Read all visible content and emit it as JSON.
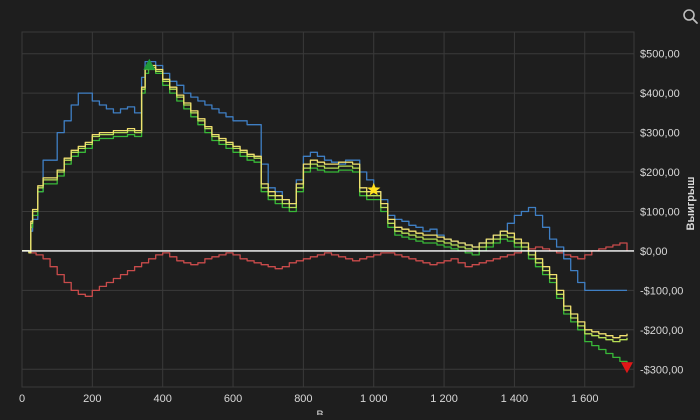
{
  "colors": {
    "background": "#1e1e1e",
    "grid": "#3a3a3a",
    "axis_text": "#d8d8d8",
    "zero_line": "#ffffff",
    "blue": "#3f7fc4",
    "red": "#c94b4b",
    "green": "#38b838",
    "lightgreen": "#b6df55",
    "yellow": "#f0e070",
    "marker_peak": "#1f9a3a",
    "marker_star": "#ffe020",
    "marker_low": "#e01818"
  },
  "toolbar": {
    "zoom_icon": "magnifier-icon"
  },
  "chart_data": {
    "type": "line",
    "ylabel": "Выигрыш",
    "xlabel": "В",
    "xlim": [
      0,
      1740
    ],
    "ylim": [
      -345,
      555
    ],
    "x_ticks": [
      0,
      200,
      400,
      600,
      800,
      1000,
      1200,
      1400,
      1600
    ],
    "x_tick_labels": [
      "0",
      "200",
      "400",
      "600",
      "800",
      "1 000",
      "1 200",
      "1 400",
      "1 600"
    ],
    "y_ticks": [
      500,
      400,
      300,
      200,
      100,
      0,
      -100,
      -200,
      -300
    ],
    "y_tick_labels": [
      "$500,00",
      "$400,00",
      "$300,00",
      "$200,00",
      "$100,00",
      "$0,00",
      "-$100,00",
      "-$200,00",
      "-$300,00"
    ],
    "grid": true,
    "series": [
      {
        "color_key": "blue",
        "x": [
          0,
          20,
          25,
          30,
          45,
          60,
          100,
          120,
          140,
          160,
          180,
          200,
          220,
          240,
          260,
          280,
          300,
          320,
          340,
          350,
          360,
          380,
          400,
          420,
          440,
          460,
          480,
          500,
          520,
          540,
          560,
          580,
          600,
          620,
          640,
          660,
          680,
          700,
          720,
          740,
          760,
          780,
          800,
          820,
          840,
          860,
          880,
          900,
          920,
          940,
          960,
          980,
          1000,
          1020,
          1040,
          1060,
          1080,
          1100,
          1120,
          1140,
          1160,
          1180,
          1200,
          1220,
          1240,
          1260,
          1280,
          1300,
          1320,
          1340,
          1360,
          1380,
          1400,
          1420,
          1440,
          1460,
          1480,
          1500,
          1520,
          1540,
          1560,
          1580,
          1600,
          1620,
          1640,
          1660,
          1680,
          1700,
          1720
        ],
        "y": [
          0,
          -5,
          50,
          80,
          150,
          230,
          300,
          330,
          370,
          400,
          400,
          380,
          370,
          360,
          350,
          360,
          365,
          350,
          440,
          480,
          480,
          470,
          450,
          430,
          420,
          400,
          390,
          380,
          370,
          360,
          350,
          340,
          330,
          330,
          320,
          320,
          220,
          160,
          150,
          130,
          120,
          180,
          240,
          250,
          240,
          230,
          225,
          220,
          230,
          230,
          200,
          180,
          150,
          130,
          90,
          80,
          75,
          65,
          60,
          50,
          55,
          40,
          30,
          25,
          20,
          15,
          10,
          20,
          30,
          40,
          50,
          70,
          90,
          100,
          110,
          90,
          60,
          30,
          10,
          -20,
          -50,
          -80,
          -100,
          -100,
          -100,
          -100,
          -100,
          -100,
          -100
        ]
      },
      {
        "color_key": "red",
        "x": [
          0,
          20,
          40,
          60,
          80,
          100,
          120,
          140,
          160,
          180,
          200,
          220,
          240,
          260,
          280,
          300,
          320,
          340,
          360,
          380,
          400,
          420,
          440,
          460,
          480,
          500,
          520,
          540,
          560,
          580,
          600,
          620,
          640,
          660,
          680,
          700,
          720,
          740,
          760,
          780,
          800,
          820,
          840,
          860,
          880,
          900,
          920,
          940,
          960,
          980,
          1000,
          1020,
          1040,
          1060,
          1080,
          1100,
          1120,
          1140,
          1160,
          1180,
          1200,
          1220,
          1240,
          1260,
          1280,
          1300,
          1320,
          1340,
          1360,
          1380,
          1400,
          1420,
          1440,
          1460,
          1480,
          1500,
          1520,
          1540,
          1560,
          1580,
          1600,
          1620,
          1640,
          1660,
          1680,
          1700,
          1720
        ],
        "y": [
          0,
          -5,
          -10,
          -20,
          -40,
          -60,
          -80,
          -100,
          -110,
          -115,
          -100,
          -90,
          -80,
          -70,
          -60,
          -50,
          -40,
          -30,
          -20,
          -10,
          -5,
          -15,
          -25,
          -30,
          -35,
          -30,
          -20,
          -15,
          -10,
          -5,
          -10,
          -20,
          -25,
          -30,
          -35,
          -40,
          -45,
          -40,
          -30,
          -25,
          -20,
          -15,
          -10,
          -5,
          -10,
          -15,
          -20,
          -25,
          -20,
          -15,
          -10,
          -5,
          -5,
          -10,
          -15,
          -20,
          -25,
          -30,
          -35,
          -30,
          -25,
          -20,
          -30,
          -40,
          -35,
          -30,
          -25,
          -20,
          -15,
          -10,
          -5,
          0,
          5,
          10,
          5,
          0,
          -5,
          -10,
          -15,
          -20,
          -10,
          0,
          5,
          10,
          15,
          20,
          0
        ]
      },
      {
        "color_key": "green",
        "x": [
          0,
          20,
          25,
          30,
          45,
          60,
          100,
          120,
          140,
          160,
          180,
          200,
          220,
          240,
          260,
          280,
          300,
          320,
          340,
          350,
          360,
          380,
          400,
          420,
          440,
          460,
          480,
          500,
          520,
          540,
          560,
          580,
          600,
          620,
          640,
          660,
          680,
          700,
          720,
          740,
          760,
          780,
          800,
          820,
          840,
          860,
          880,
          900,
          920,
          940,
          960,
          980,
          1000,
          1020,
          1040,
          1060,
          1080,
          1100,
          1120,
          1140,
          1160,
          1180,
          1200,
          1220,
          1240,
          1260,
          1280,
          1300,
          1320,
          1340,
          1360,
          1380,
          1400,
          1420,
          1440,
          1460,
          1480,
          1500,
          1520,
          1540,
          1560,
          1580,
          1600,
          1620,
          1640,
          1660,
          1680,
          1700,
          1720
        ],
        "y": [
          0,
          -5,
          60,
          90,
          150,
          170,
          190,
          220,
          240,
          250,
          260,
          280,
          285,
          285,
          290,
          290,
          295,
          290,
          400,
          450,
          460,
          450,
          420,
          400,
          380,
          360,
          340,
          320,
          300,
          280,
          270,
          260,
          250,
          240,
          230,
          225,
          150,
          130,
          120,
          110,
          100,
          150,
          200,
          210,
          205,
          200,
          200,
          205,
          205,
          200,
          140,
          130,
          130,
          100,
          60,
          40,
          35,
          30,
          25,
          20,
          20,
          15,
          10,
          5,
          0,
          -5,
          -10,
          0,
          10,
          20,
          30,
          25,
          10,
          0,
          -20,
          -40,
          -60,
          -80,
          -120,
          -160,
          -180,
          -200,
          -230,
          -240,
          -250,
          -260,
          -270,
          -280,
          -285
        ]
      },
      {
        "color_key": "lightgreen",
        "x": [
          0,
          20,
          25,
          30,
          45,
          60,
          100,
          120,
          140,
          160,
          180,
          200,
          220,
          240,
          260,
          280,
          300,
          320,
          340,
          350,
          360,
          380,
          400,
          420,
          440,
          460,
          480,
          500,
          520,
          540,
          560,
          580,
          600,
          620,
          640,
          660,
          680,
          700,
          720,
          740,
          760,
          780,
          800,
          820,
          840,
          860,
          880,
          900,
          920,
          940,
          960,
          980,
          1000,
          1020,
          1040,
          1060,
          1080,
          1100,
          1120,
          1140,
          1160,
          1180,
          1200,
          1220,
          1240,
          1260,
          1280,
          1300,
          1320,
          1340,
          1360,
          1380,
          1400,
          1420,
          1440,
          1460,
          1480,
          1500,
          1520,
          1540,
          1560,
          1580,
          1600,
          1620,
          1640,
          1660,
          1680,
          1700,
          1720
        ],
        "y": [
          0,
          -5,
          70,
          100,
          160,
          180,
          200,
          230,
          250,
          260,
          270,
          290,
          295,
          295,
          300,
          300,
          305,
          300,
          410,
          460,
          465,
          455,
          430,
          410,
          390,
          370,
          350,
          330,
          310,
          290,
          280,
          270,
          260,
          250,
          240,
          235,
          160,
          140,
          130,
          120,
          110,
          160,
          210,
          220,
          215,
          210,
          210,
          215,
          215,
          210,
          150,
          140,
          140,
          110,
          70,
          50,
          45,
          40,
          35,
          30,
          30,
          25,
          20,
          15,
          10,
          5,
          0,
          10,
          20,
          30,
          40,
          35,
          20,
          10,
          -10,
          -30,
          -50,
          -70,
          -110,
          -150,
          -170,
          -190,
          -210,
          -215,
          -220,
          -225,
          -230,
          -225,
          -220
        ]
      },
      {
        "color_key": "yellow",
        "x": [
          0,
          20,
          25,
          30,
          45,
          60,
          100,
          120,
          140,
          160,
          180,
          200,
          220,
          240,
          260,
          280,
          300,
          320,
          340,
          350,
          360,
          380,
          400,
          420,
          440,
          460,
          480,
          500,
          520,
          540,
          560,
          580,
          600,
          620,
          640,
          660,
          680,
          700,
          720,
          740,
          760,
          780,
          800,
          820,
          840,
          860,
          880,
          900,
          920,
          940,
          960,
          980,
          1000,
          1020,
          1040,
          1060,
          1080,
          1100,
          1120,
          1140,
          1160,
          1180,
          1200,
          1220,
          1240,
          1260,
          1280,
          1300,
          1320,
          1340,
          1360,
          1380,
          1400,
          1420,
          1440,
          1460,
          1480,
          1500,
          1520,
          1540,
          1560,
          1580,
          1600,
          1620,
          1640,
          1660,
          1680,
          1700,
          1720
        ],
        "y": [
          0,
          -5,
          75,
          105,
          165,
          185,
          205,
          235,
          255,
          265,
          275,
          295,
          300,
          300,
          305,
          305,
          310,
          305,
          415,
          465,
          470,
          460,
          435,
          415,
          395,
          375,
          355,
          335,
          315,
          295,
          285,
          275,
          265,
          255,
          245,
          240,
          170,
          150,
          140,
          130,
          120,
          170,
          220,
          230,
          225,
          220,
          220,
          225,
          225,
          220,
          160,
          150,
          150,
          120,
          80,
          60,
          55,
          50,
          45,
          40,
          40,
          35,
          30,
          25,
          20,
          15,
          10,
          20,
          30,
          40,
          50,
          45,
          30,
          20,
          0,
          -20,
          -40,
          -60,
          -100,
          -140,
          -160,
          -180,
          -200,
          -205,
          -210,
          -215,
          -220,
          -215,
          -210
        ]
      }
    ],
    "markers": [
      {
        "shape": "triangle-up",
        "color_key": "marker_peak",
        "x": 362,
        "y": 472
      },
      {
        "shape": "star",
        "color_key": "marker_star",
        "x": 1000,
        "y": 155
      },
      {
        "shape": "triangle-down",
        "color_key": "marker_low",
        "x": 1720,
        "y": -295
      }
    ]
  }
}
